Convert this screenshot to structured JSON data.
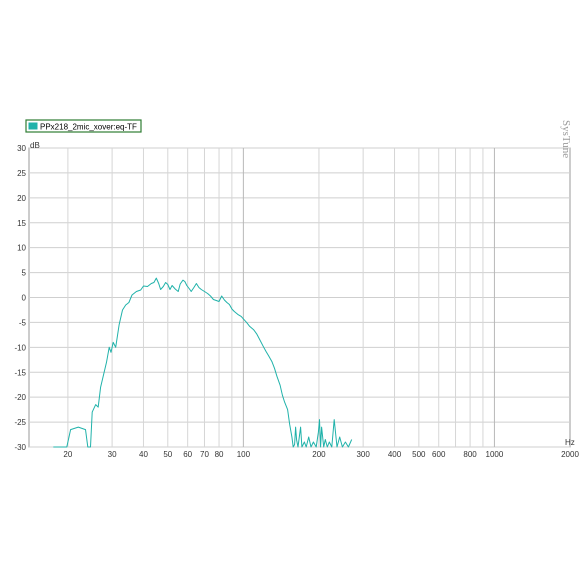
{
  "watermark": "SysTune",
  "chart_data": {
    "type": "line",
    "title": "",
    "xlabel": "Hz",
    "ylabel": "dB",
    "x_scale": "log",
    "xlim": [
      14,
      2000
    ],
    "ylim": [
      -30,
      30
    ],
    "grid": true,
    "legend_position": "top-left",
    "x_ticks": [
      20,
      30,
      40,
      50,
      60,
      70,
      80,
      100,
      200,
      300,
      400,
      500,
      600,
      800,
      1000,
      2000
    ],
    "y_ticks": [
      30,
      25,
      20,
      15,
      10,
      5,
      0,
      -5,
      -10,
      -15,
      -20,
      -25,
      -30
    ],
    "series": [
      {
        "name": "PPx218_2mic_xover:eq-TF",
        "color": "#20b2aa",
        "x": [
          17.5,
          18,
          19,
          19.8,
          20.5,
          22,
          23.5,
          24,
          24.6,
          25,
          25.8,
          26.4,
          27,
          28.5,
          29.2,
          29.7,
          30.3,
          31,
          32,
          33,
          34,
          35,
          36,
          37.5,
          39,
          40,
          41.5,
          43,
          44,
          45,
          46,
          46.8,
          48,
          49,
          50,
          51,
          52,
          53.5,
          55,
          56,
          57.5,
          58.5,
          59.5,
          61,
          62,
          63.5,
          65,
          66.5,
          68,
          70,
          72,
          74,
          76,
          78,
          80,
          82,
          84,
          86,
          88,
          90,
          92,
          95,
          98,
          100,
          103,
          106,
          110,
          113,
          116,
          120,
          123,
          126,
          130,
          133,
          136,
          140,
          143,
          146,
          150,
          153,
          156,
          158,
          160,
          161.5,
          163,
          165,
          167,
          169,
          171,
          175,
          178,
          182,
          186,
          190,
          195,
          199,
          201,
          203,
          205,
          209,
          212,
          216,
          220,
          225,
          230,
          236,
          242,
          248,
          255,
          262,
          270
        ],
        "values": [
          -30,
          -30,
          -30,
          -30,
          -26.5,
          -26,
          -26.5,
          -30,
          -30,
          -23,
          -21.5,
          -22,
          -18,
          -13,
          -10,
          -11,
          -9,
          -10,
          -5.5,
          -2.5,
          -1.5,
          -1,
          0.5,
          1.2,
          1.5,
          2.3,
          2.2,
          2.8,
          3.0,
          3.9,
          2.8,
          1.6,
          2.2,
          3.0,
          2.6,
          1.6,
          2.4,
          1.7,
          1.2,
          2.7,
          3.5,
          3.2,
          2.4,
          1.7,
          1.2,
          2.0,
          2.8,
          2.0,
          1.6,
          1.2,
          0.8,
          0.3,
          -0.4,
          -0.6,
          -0.8,
          0.3,
          -0.5,
          -1.0,
          -1.4,
          -2.3,
          -2.8,
          -3.4,
          -3.8,
          -4.3,
          -5.0,
          -5.8,
          -6.5,
          -7.3,
          -8.4,
          -9.8,
          -10.8,
          -11.7,
          -12.9,
          -14.2,
          -15.8,
          -17.6,
          -19.6,
          -21.0,
          -22.5,
          -25.5,
          -28.0,
          -30.0,
          -29.5,
          -26.0,
          -28.6,
          -30.0,
          -28.0,
          -26.0,
          -30.0,
          -29.0,
          -30.0,
          -28.0,
          -30.0,
          -29.0,
          -30.0,
          -27.0,
          -24.5,
          -30.0,
          -26.0,
          -30.0,
          -28.5,
          -30.0,
          -29.0,
          -30.0,
          -24.5,
          -30.0,
          -28.0,
          -30.0,
          -29.0,
          -30.0,
          -28.5
        ]
      }
    ]
  }
}
